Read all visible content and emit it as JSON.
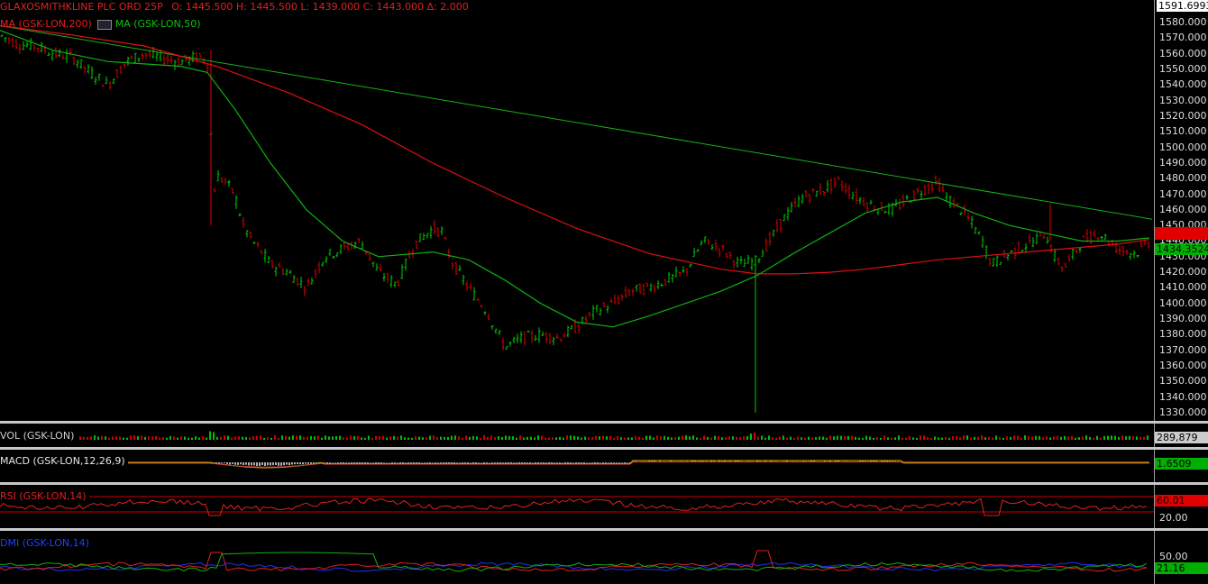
{
  "price": {
    "title": "GLAXOSMITHKLINE PLC ORD 25P",
    "ohlc": "O: 1445.500  H: 1445.500  L: 1439.000  C: 1443.000  Δ: 2.000",
    "ma200_label": "MA (GSK-LON,200)",
    "ma50_label": "MA (GSK-LON,50)",
    "top_value": "1591.6993",
    "last_price": "1434.3524",
    "ticks": [
      "1580.000",
      "1570.000",
      "1560.000",
      "1550.000",
      "1540.000",
      "1530.000",
      "1520.000",
      "1510.000",
      "1500.000",
      "1490.000",
      "1480.000",
      "1470.000",
      "1460.000",
      "1450.000",
      "1440.000",
      "1430.000",
      "1420.000",
      "1410.000",
      "1400.000",
      "1390.000",
      "1380.000",
      "1370.000",
      "1360.000",
      "1350.000",
      "1340.000",
      "1330.000"
    ],
    "colors": {
      "up": "#00d000",
      "down": "#e00000",
      "ma200": "#e01010",
      "ma50": "#10b010",
      "trend": "#18b018"
    }
  },
  "volume": {
    "label": "VOL (GSK-LON)",
    "value": "289,879"
  },
  "macd": {
    "label": "MACD (GSK-LON,12,26,9)",
    "value": "1.6509"
  },
  "rsi": {
    "label": "RSI (GSK-LON,14)",
    "value": "60.01",
    "low_level": "20.00"
  },
  "dmi": {
    "label": "DMI (GSK-LON,14)",
    "value": "21.16",
    "level": "50.00"
  },
  "chart_data": {
    "type": "line",
    "title": "GLAXOSMITHKLINE PLC ORD 25P",
    "ylim": [
      1330,
      1591.7
    ],
    "series": [
      {
        "name": "GSK-LON",
        "x": [
          0,
          20,
          40,
          60,
          80,
          100,
          120,
          140,
          160,
          180,
          200,
          220,
          228,
          232,
          236,
          240,
          250,
          260,
          270,
          280,
          290,
          300,
          320,
          340,
          360,
          380,
          400,
          420,
          440,
          460,
          480,
          490,
          500,
          520,
          540,
          560,
          580,
          600,
          620,
          640,
          660,
          680,
          700,
          720,
          740,
          760,
          780,
          800,
          820,
          838,
          850,
          870,
          890,
          910,
          930,
          950,
          970,
          990,
          1010,
          1030,
          1040,
          1050,
          1070,
          1090,
          1100,
          1120,
          1140,
          1160,
          1170,
          1180,
          1200,
          1220,
          1240,
          1260,
          1275
        ],
        "values": [
          1572,
          1566,
          1565,
          1560,
          1558,
          1548,
          1540,
          1555,
          1560,
          1557,
          1555,
          1558,
          1556,
          1552,
          1465,
          1482,
          1478,
          1470,
          1450,
          1440,
          1433,
          1425,
          1420,
          1410,
          1430,
          1435,
          1440,
          1420,
          1412,
          1438,
          1448,
          1446,
          1428,
          1410,
          1395,
          1372,
          1378,
          1380,
          1378,
          1385,
          1395,
          1400,
          1408,
          1410,
          1415,
          1420,
          1440,
          1435,
          1425,
          1427,
          1437,
          1455,
          1468,
          1472,
          1478,
          1468,
          1462,
          1460,
          1468,
          1475,
          1478,
          1468,
          1458,
          1440,
          1425,
          1432,
          1438,
          1445,
          1430,
          1422,
          1440,
          1445,
          1435,
          1432,
          1440
        ]
      },
      {
        "name": "MA (GSK-LON,50)",
        "x": [
          0,
          60,
          120,
          200,
          230,
          260,
          300,
          340,
          380,
          420,
          480,
          520,
          560,
          600,
          640,
          680,
          720,
          760,
          800,
          840,
          880,
          920,
          960,
          1000,
          1040,
          1080,
          1120,
          1160,
          1200,
          1240,
          1275
        ],
        "values": [
          1575,
          1562,
          1555,
          1552,
          1548,
          1525,
          1490,
          1460,
          1440,
          1430,
          1433,
          1428,
          1415,
          1400,
          1388,
          1385,
          1392,
          1400,
          1408,
          1418,
          1432,
          1445,
          1458,
          1465,
          1468,
          1458,
          1450,
          1445,
          1440,
          1440,
          1442
        ]
      },
      {
        "name": "MA (GSK-LON,200)",
        "x": [
          0,
          80,
          160,
          240,
          320,
          400,
          480,
          560,
          640,
          720,
          800,
          840,
          880,
          920,
          960,
          1000,
          1040,
          1080,
          1120,
          1160,
          1200,
          1240,
          1275
        ],
        "values": [
          1578,
          1572,
          1565,
          1552,
          1535,
          1515,
          1490,
          1468,
          1448,
          1432,
          1422,
          1419,
          1419,
          1420,
          1422,
          1425,
          1428,
          1430,
          1432,
          1434,
          1436,
          1438,
          1441
        ]
      },
      {
        "name": "Trendline",
        "x": [
          0,
          1278
        ],
        "values": [
          1578,
          1454
        ]
      }
    ]
  }
}
